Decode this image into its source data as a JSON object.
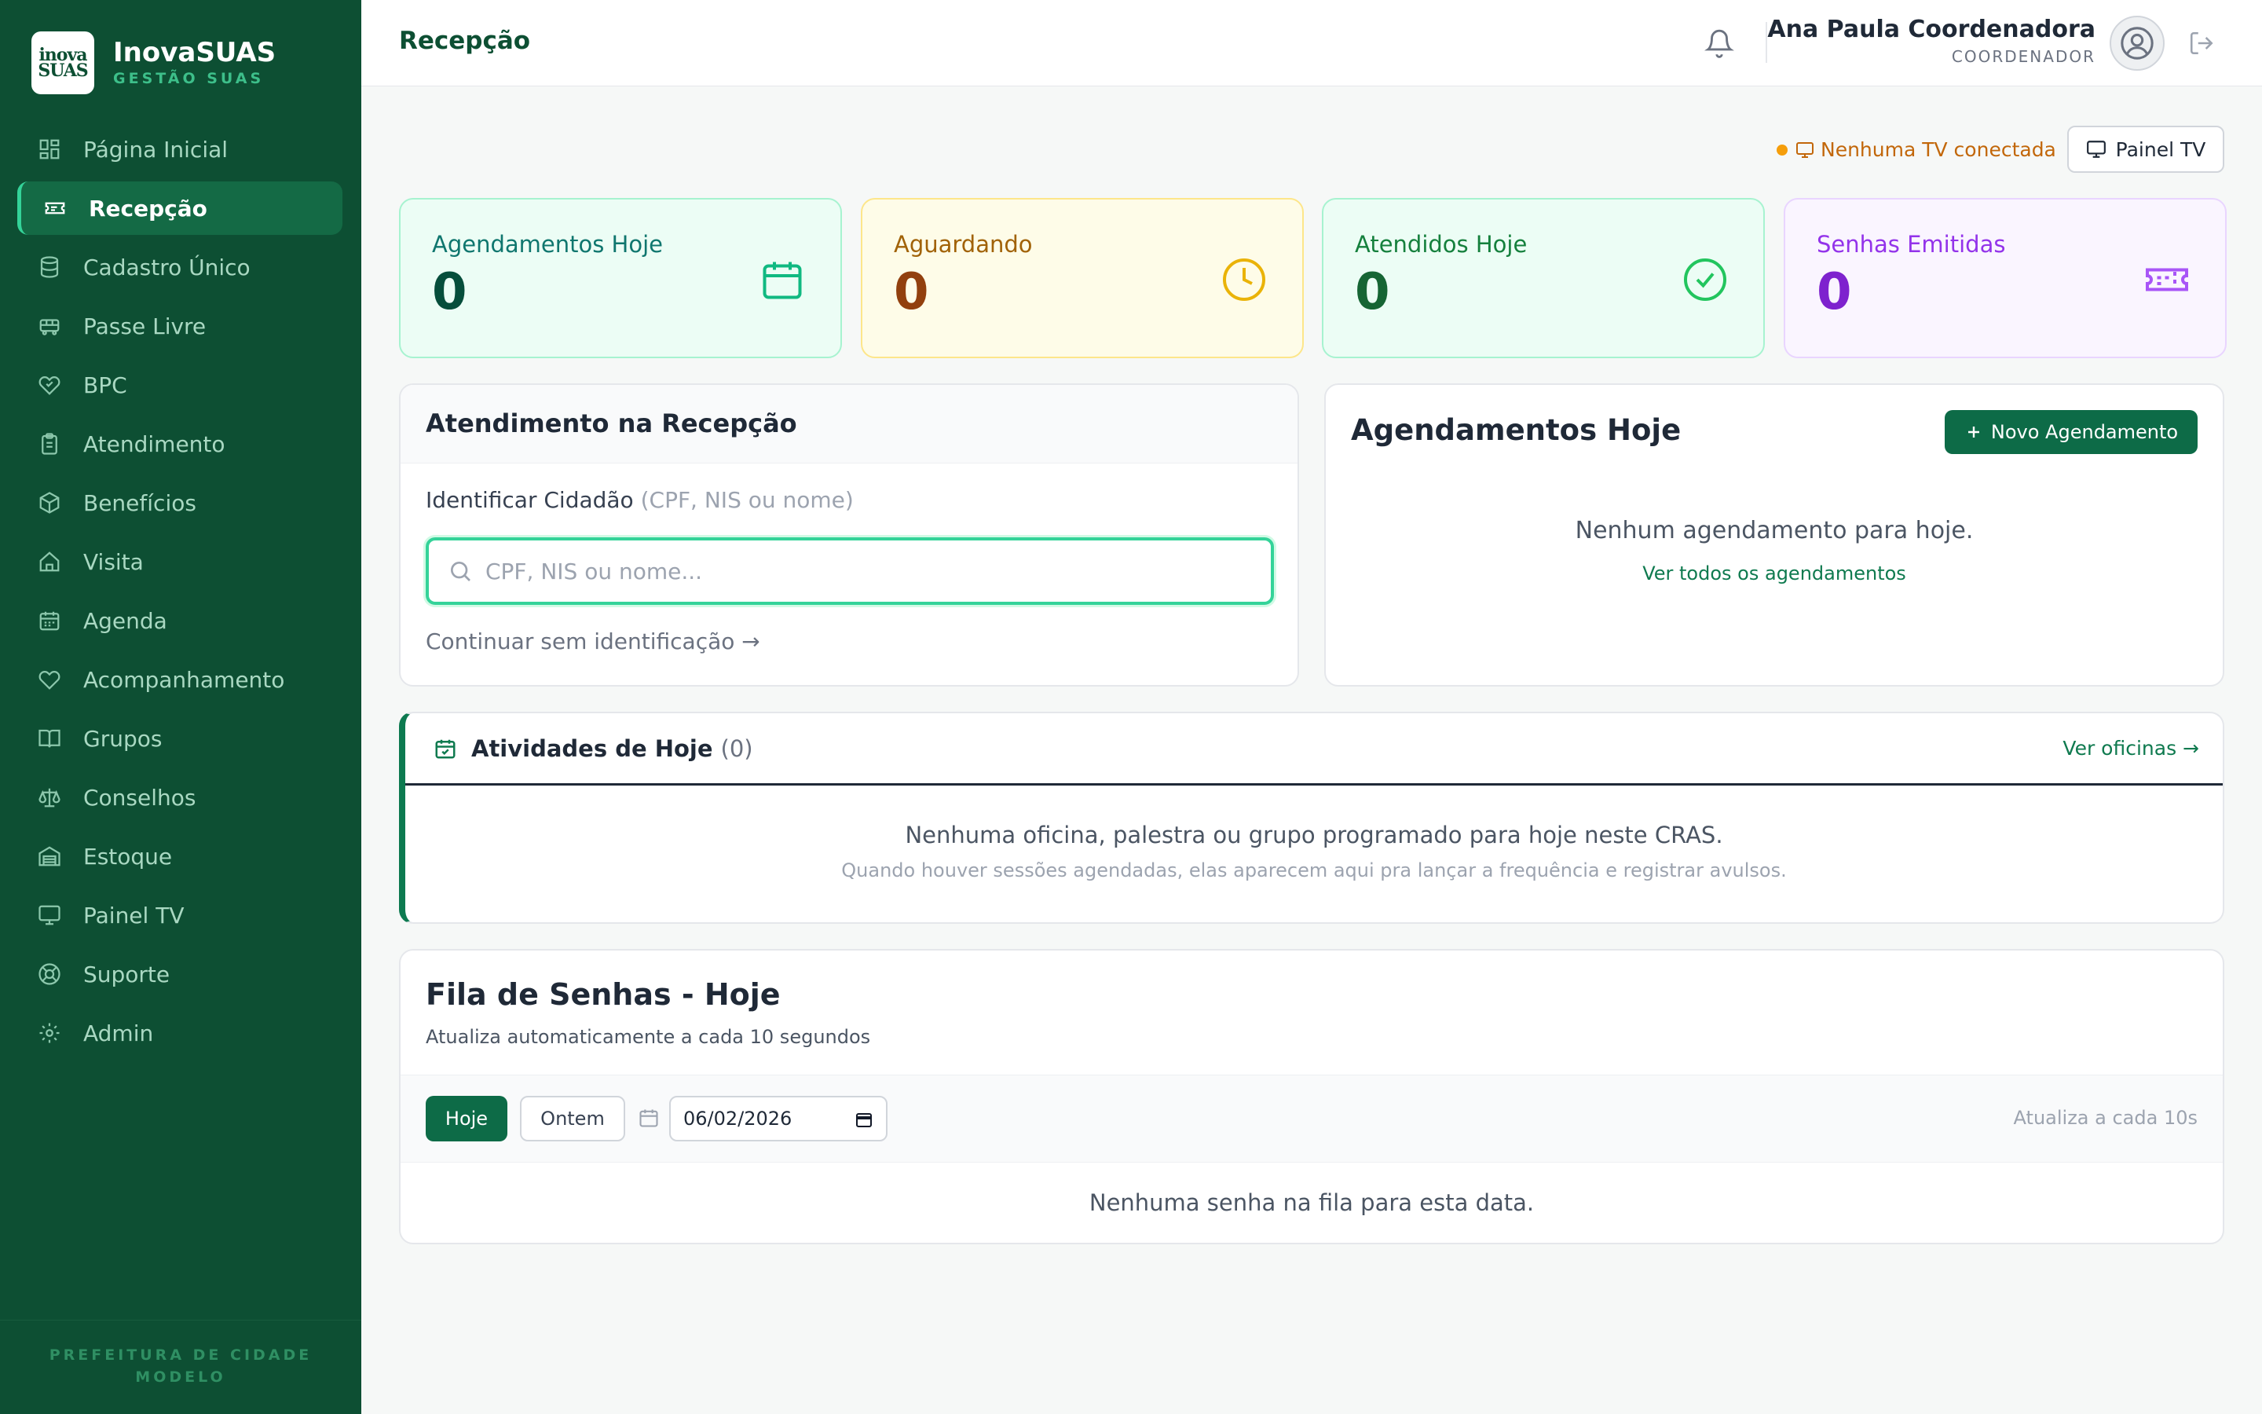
{
  "brand": {
    "logo_text_1": "inova",
    "logo_text_2": "SUAS",
    "name": "InovaSUAS",
    "subtitle": "GESTÃO SUAS"
  },
  "sidebar": {
    "items": [
      {
        "label": "Página Inicial",
        "icon": "grid-icon"
      },
      {
        "label": "Recepção",
        "icon": "ticket-icon",
        "active": true
      },
      {
        "label": "Cadastro Único",
        "icon": "database-icon"
      },
      {
        "label": "Passe Livre",
        "icon": "bus-icon"
      },
      {
        "label": "BPC",
        "icon": "heart-handshake-icon"
      },
      {
        "label": "Atendimento",
        "icon": "clipboard-icon"
      },
      {
        "label": "Benefícios",
        "icon": "package-icon"
      },
      {
        "label": "Visita",
        "icon": "home-icon"
      },
      {
        "label": "Agenda",
        "icon": "calendar-icon"
      },
      {
        "label": "Acompanhamento",
        "icon": "heart-icon"
      },
      {
        "label": "Grupos",
        "icon": "book-icon"
      },
      {
        "label": "Conselhos",
        "icon": "scale-icon"
      },
      {
        "label": "Estoque",
        "icon": "warehouse-icon"
      },
      {
        "label": "Painel TV",
        "icon": "monitor-icon"
      },
      {
        "label": "Suporte",
        "icon": "lifebuoy-icon"
      },
      {
        "label": "Admin",
        "icon": "gear-icon"
      }
    ],
    "footer": "PREFEITURA DE CIDADE MODELO"
  },
  "header": {
    "title": "Recepção",
    "user_name": "Ana Paula Coordenadora",
    "user_role": "COORDENADOR"
  },
  "tv": {
    "status": "Nenhuma TV conectada",
    "button": "Painel TV",
    "status_color": "#c2670a"
  },
  "stats": [
    {
      "label": "Agendamentos Hoje",
      "value": "0",
      "icon": "calendar-icon",
      "color": "#10b981"
    },
    {
      "label": "Aguardando",
      "value": "0",
      "icon": "clock-icon",
      "color": "#eab308"
    },
    {
      "label": "Atendidos Hoje",
      "value": "0",
      "icon": "check-circle-icon",
      "color": "#22c55e"
    },
    {
      "label": "Senhas Emitidas",
      "value": "0",
      "icon": "ticket-icon",
      "color": "#a855f7"
    }
  ],
  "atendimento": {
    "title": "Atendimento na Recepção",
    "identify_label": "Identificar Cidadão",
    "identify_hint": "(CPF, NIS ou nome)",
    "search_placeholder": "CPF, NIS ou nome...",
    "search_value": "",
    "continue_link": "Continuar sem identificação →"
  },
  "agendamentos": {
    "title": "Agendamentos Hoje",
    "new_button": "Novo Agendamento",
    "empty": "Nenhum agendamento para hoje.",
    "link": "Ver todos os agendamentos"
  },
  "atividades": {
    "title": "Atividades de Hoje",
    "count": "(0)",
    "link": "Ver oficinas →",
    "empty": "Nenhuma oficina, palestra ou grupo programado para hoje neste CRAS.",
    "sub": "Quando houver sessões agendadas, elas aparecem aqui pra lançar a frequência e registrar avulsos."
  },
  "fila": {
    "title": "Fila de Senhas - Hoje",
    "subtitle": "Atualiza automaticamente a cada 10 segundos",
    "today_button": "Hoje",
    "yesterday_button": "Ontem",
    "date": "06/02/2026",
    "auto_refresh": "Atualiza a cada 10s",
    "empty": "Nenhuma senha na fila para esta data."
  },
  "colors": {
    "sidebar": "#0d4f33",
    "accent": "#0d6b47",
    "active_item": "#146a45"
  }
}
